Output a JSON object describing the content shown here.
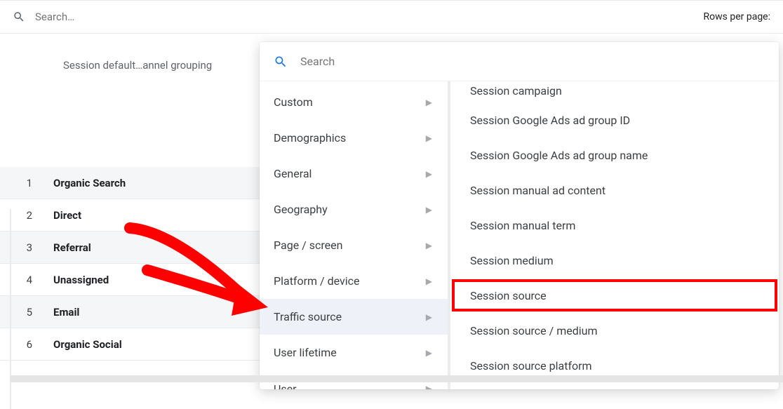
{
  "topbar": {
    "search_placeholder": "Search…",
    "rows_per_page_label": "Rows per page:"
  },
  "dimension": {
    "label": "Session default…annel grouping"
  },
  "rows": [
    {
      "idx": "1",
      "name": "Organic Search"
    },
    {
      "idx": "2",
      "name": "Direct"
    },
    {
      "idx": "3",
      "name": "Referral"
    },
    {
      "idx": "4",
      "name": "Unassigned"
    },
    {
      "idx": "5",
      "name": "Email"
    },
    {
      "idx": "6",
      "name": "Organic Social"
    }
  ],
  "popover": {
    "search_placeholder": "Search",
    "categories": [
      {
        "label": "Custom"
      },
      {
        "label": "Demographics"
      },
      {
        "label": "General"
      },
      {
        "label": "Geography"
      },
      {
        "label": "Page / screen"
      },
      {
        "label": "Platform / device"
      },
      {
        "label": "Traffic source"
      },
      {
        "label": "User lifetime"
      },
      {
        "label": "User"
      }
    ],
    "cut_option": "Session campaign",
    "options": [
      "Session Google Ads ad group ID",
      "Session Google Ads ad group name",
      "Session manual ad content",
      "Session manual term",
      "Session medium",
      "Session source",
      "Session source / medium",
      "Session source platform"
    ],
    "highlight_index": 5
  }
}
